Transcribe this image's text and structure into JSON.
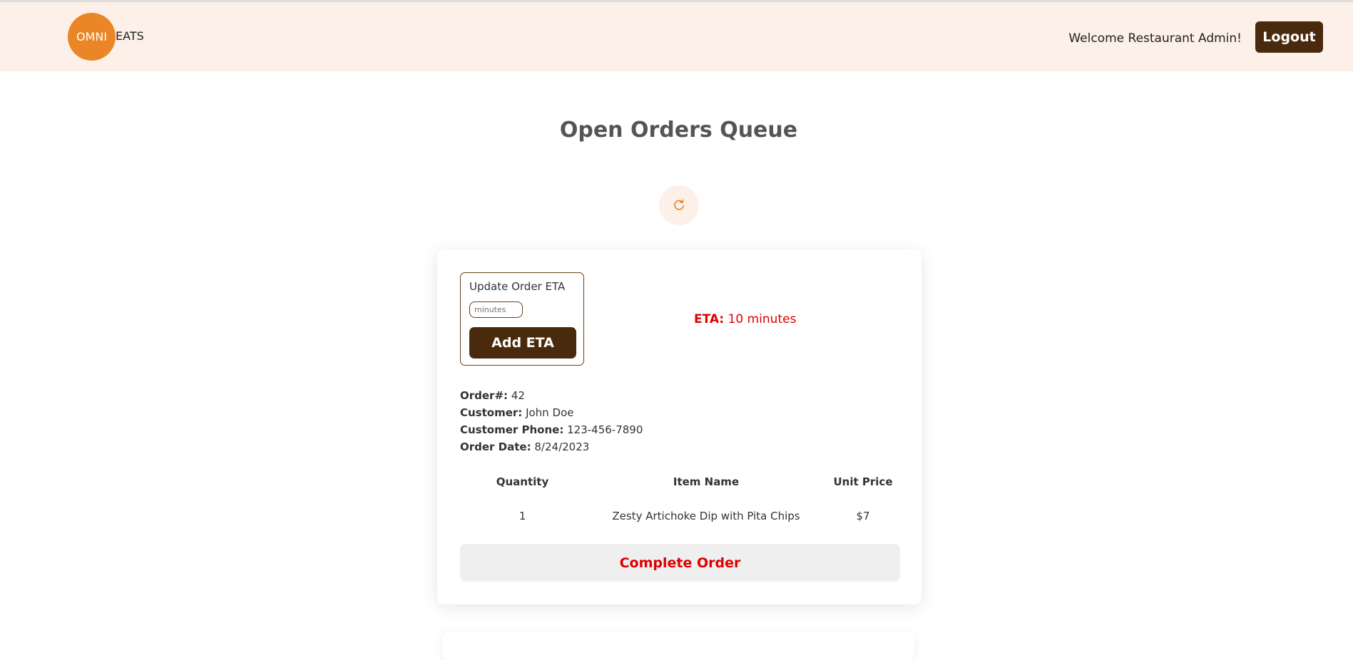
{
  "header": {
    "logo_circle_text": "OMNI",
    "logo_text": "EATS",
    "welcome_text": "Welcome Restaurant Admin!",
    "logout_label": "Logout"
  },
  "main": {
    "title": "Open Orders Queue",
    "refresh_icon": "refresh-icon"
  },
  "order": {
    "eta_box_label": "Update Order ETA",
    "eta_input_placeholder": "minutes",
    "eta_input_value": "",
    "add_eta_label": "Add ETA",
    "eta_label": "ETA:",
    "eta_value": "10 minutes",
    "order_number_label": "Order#:",
    "order_number": "42",
    "customer_label": "Customer:",
    "customer": "John Doe",
    "phone_label": "Customer Phone:",
    "phone": "123-456-7890",
    "date_label": "Order Date:",
    "date": "8/24/2023",
    "columns": [
      "Quantity",
      "Item Name",
      "Unit Price"
    ],
    "items": [
      {
        "quantity": "1",
        "name": "Zesty Artichoke Dip with Pita Chips",
        "price": "$7"
      }
    ],
    "complete_label": "Complete Order"
  },
  "colors": {
    "brand_orange": "#ea8627",
    "brown": "#4a2a0c",
    "header_bg": "#fdf0e8",
    "alert_red": "#e00000"
  }
}
